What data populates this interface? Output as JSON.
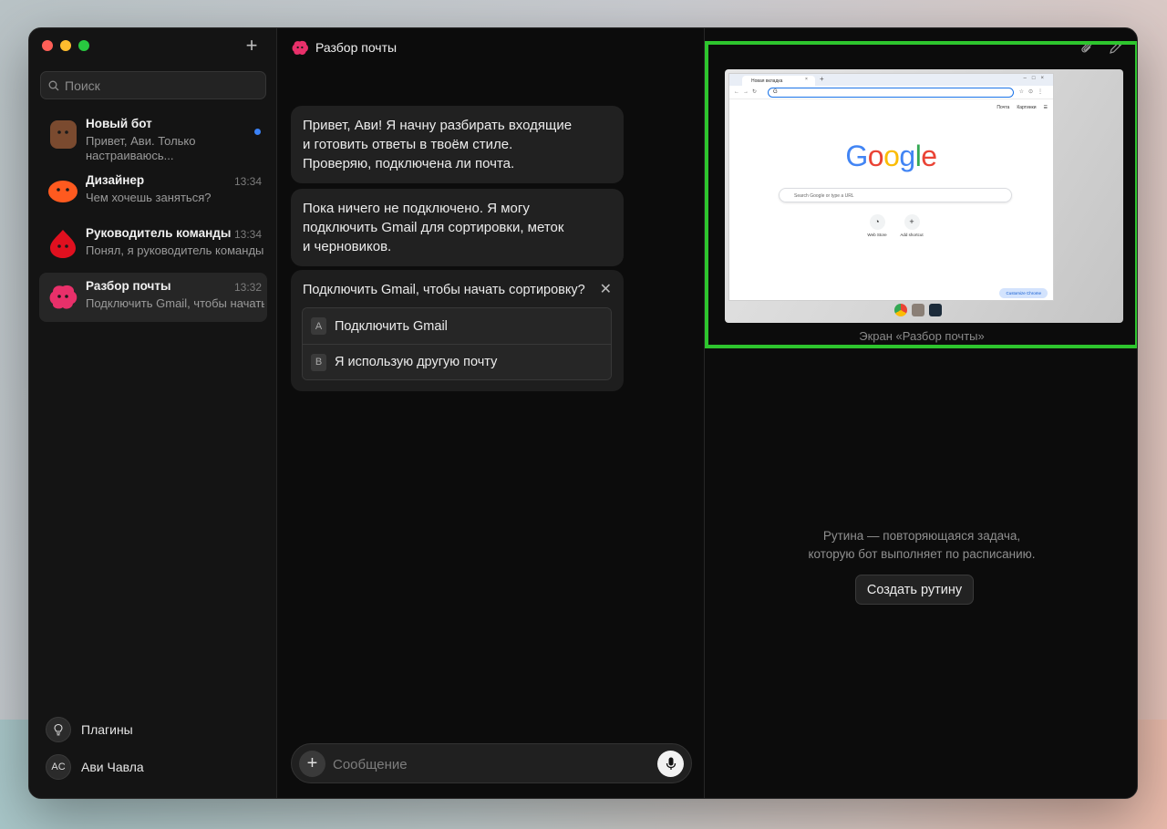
{
  "colors": {
    "accent_highlight": "#2ec52e",
    "unread_dot": "#3b82f6",
    "window_bg": "#0c0c0c",
    "sidebar_bg": "#141414"
  },
  "sidebar": {
    "new_chat_icon": "plus-icon",
    "search_placeholder": "Поиск",
    "chats": [
      {
        "name": "Новый бот",
        "preview": "Привет, Ави. Только настраиваюсь...",
        "time": "",
        "unread": true,
        "avatar_color": "#7a4a2f",
        "active": false
      },
      {
        "name": "Дизайнер",
        "preview": "Чем хочешь заняться?",
        "time": "13:34",
        "unread": false,
        "avatar_color": "#ff5a1f",
        "active": false
      },
      {
        "name": "Руководитель команды",
        "preview": "Понял, я руководитель команды",
        "time": "13:34",
        "unread": false,
        "avatar_color": "#e0101f",
        "active": false
      },
      {
        "name": "Разбор почты",
        "preview": "Подключить Gmail, чтобы начать",
        "time": "13:32",
        "unread": false,
        "avatar_color": "#e8306a",
        "active": true
      }
    ],
    "plugins_label": "Плагины",
    "user": {
      "initials": "AC",
      "name": "Ави Чавла"
    }
  },
  "chat": {
    "title": "Разбор почты",
    "messages": [
      {
        "lines": [
          "Привет, Ави! Я начну разбирать входящие",
          "и готовить ответы в твоём стиле.",
          "Проверяю, подключена ли почта."
        ]
      },
      {
        "lines": [
          "Пока ничего не подключено. Я могу",
          "подключить Gmail для сортировки, меток",
          "и черновиков."
        ]
      }
    ],
    "question": {
      "text": "Подключить Gmail, чтобы начать сортировку?",
      "options": [
        {
          "key": "A",
          "label": "Подключить Gmail"
        },
        {
          "key": "B",
          "label": "Я использую другую почту"
        }
      ]
    },
    "composer_placeholder": "Сообщение"
  },
  "right_panel": {
    "screen_caption": "Экран «Разбор почты»",
    "browser": {
      "tab_title": "Новая вкладка",
      "omnibox_text": "G",
      "header_links": [
        "Почта",
        "Картинки"
      ],
      "logo": "Google",
      "search_placeholder": "Search Google or type a URL",
      "shortcuts": [
        "Web Store",
        "Add shortcut"
      ],
      "customize_label": "Customize Chrome"
    },
    "routine_text_1": "Рутина — повторяющаяся задача,",
    "routine_text_2": "которую бот выполняет по расписанию.",
    "routine_button": "Создать рутину"
  }
}
